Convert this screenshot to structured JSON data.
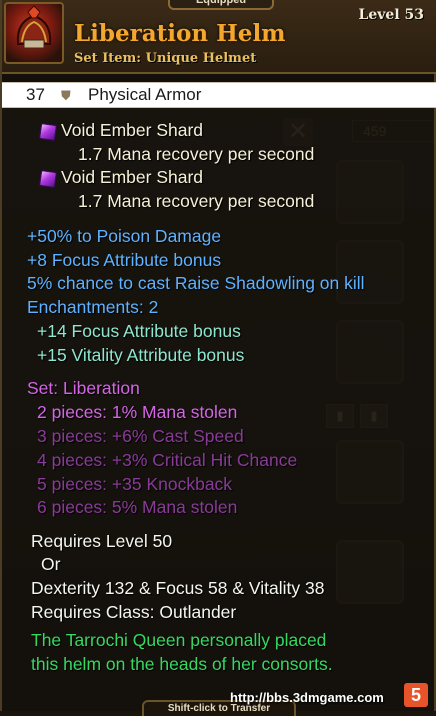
{
  "header": {
    "equipped_tab": "Equipped",
    "item_name": "Liberation Helm",
    "item_type": "Set Item: Unique Helmet",
    "level": "Level 53",
    "icon": "helmet-icon"
  },
  "armor": {
    "value": "37",
    "label": "Physical Armor",
    "icon": "shield-icon"
  },
  "sockets": [
    {
      "gem_name": "Void Ember Shard",
      "effect": "1.7 Mana recovery per second",
      "icon": "void-ember-gem-icon"
    },
    {
      "gem_name": "Void Ember Shard",
      "effect": "1.7 Mana recovery per second",
      "icon": "void-ember-gem-icon"
    }
  ],
  "stats": [
    "+50% to Poison Damage",
    "+8 Focus Attribute bonus",
    "5% chance to cast Raise Shadowling on kill"
  ],
  "enchantments": {
    "heading": "Enchantments: 2",
    "items": [
      "+14 Focus Attribute bonus",
      "+15 Vitality Attribute bonus"
    ]
  },
  "set": {
    "heading": "Set: Liberation",
    "bonuses": [
      {
        "text": "2 pieces: 1% Mana stolen",
        "active": true
      },
      {
        "text": "3 pieces: +6% Cast Speed",
        "active": false
      },
      {
        "text": "4 pieces: +3% Critical Hit Chance",
        "active": false
      },
      {
        "text": "5 pieces: +35 Knockback",
        "active": false
      },
      {
        "text": "6 pieces: 5% Mana stolen",
        "active": false
      }
    ]
  },
  "requirements": {
    "level": "Requires Level 50",
    "or": "Or",
    "attributes": "Dexterity 132 & Focus 58 & Vitality 38",
    "class": "Requires Class: Outlander"
  },
  "flavor": [
    "The Tarrochi Queen personally placed",
    "this helm on the heads of her consorts."
  ],
  "footer": {
    "transfer_hint": "Shift-click to Transfer",
    "watermark": "http://bbs.3dmgame.com",
    "watermark_logo": "5"
  },
  "colors": {
    "item_name": "#f3a72e",
    "magic_stat": "#5fb2ff",
    "enchant": "#8ee6d0",
    "set_active": "#d466e6",
    "set_inactive": "#8a3a98",
    "flavor": "#36d860"
  }
}
